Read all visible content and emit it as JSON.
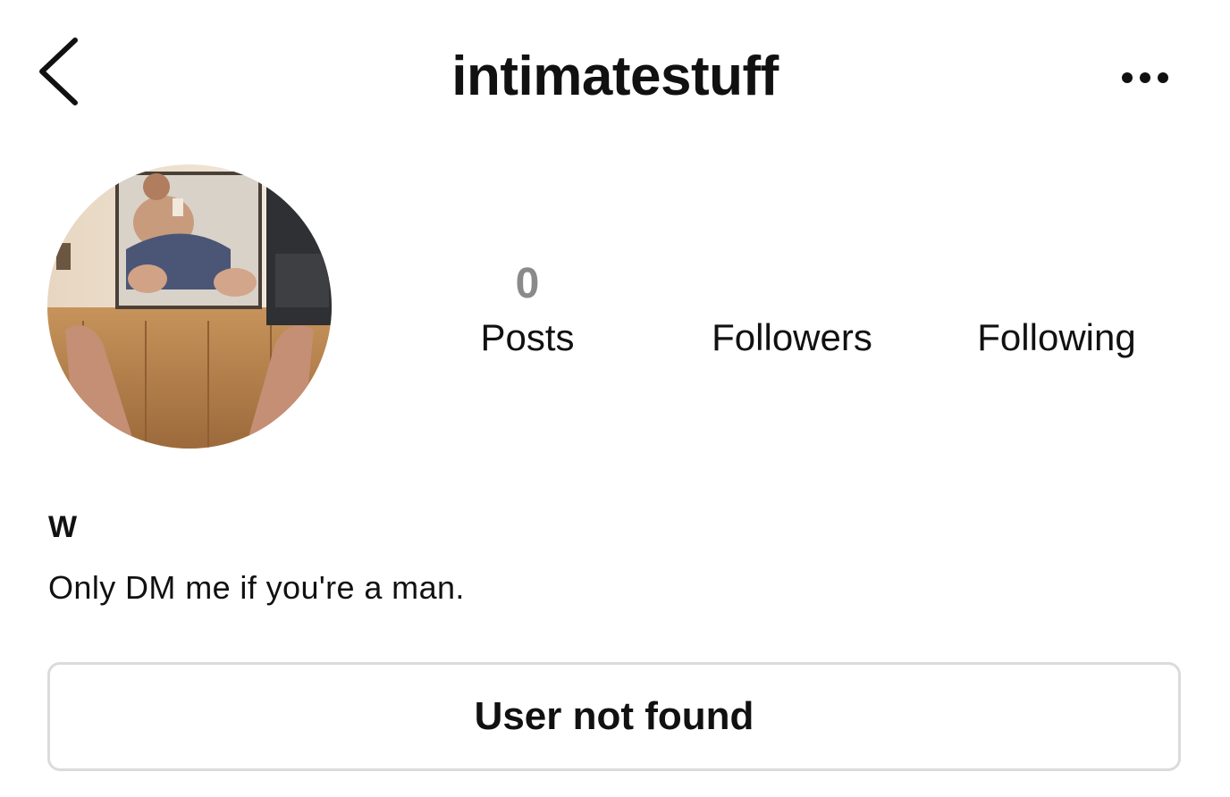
{
  "header": {
    "back_icon": "chevron-left-icon",
    "username": "intimatestuff",
    "more_icon": "more-horizontal-icon"
  },
  "profile": {
    "avatar_icon": "profile-photo",
    "stats": [
      {
        "count": "0",
        "label": "Posts"
      },
      {
        "count": "",
        "label": "Followers"
      },
      {
        "count": "",
        "label": "Following"
      }
    ],
    "display_name": "W",
    "bio": "Only DM me if you're a man."
  },
  "action": {
    "button_label": "User not found",
    "border_color": "#dbdbdb"
  },
  "colors": {
    "text": "#111111",
    "muted_count": "#8a8a8a",
    "background": "#ffffff"
  }
}
